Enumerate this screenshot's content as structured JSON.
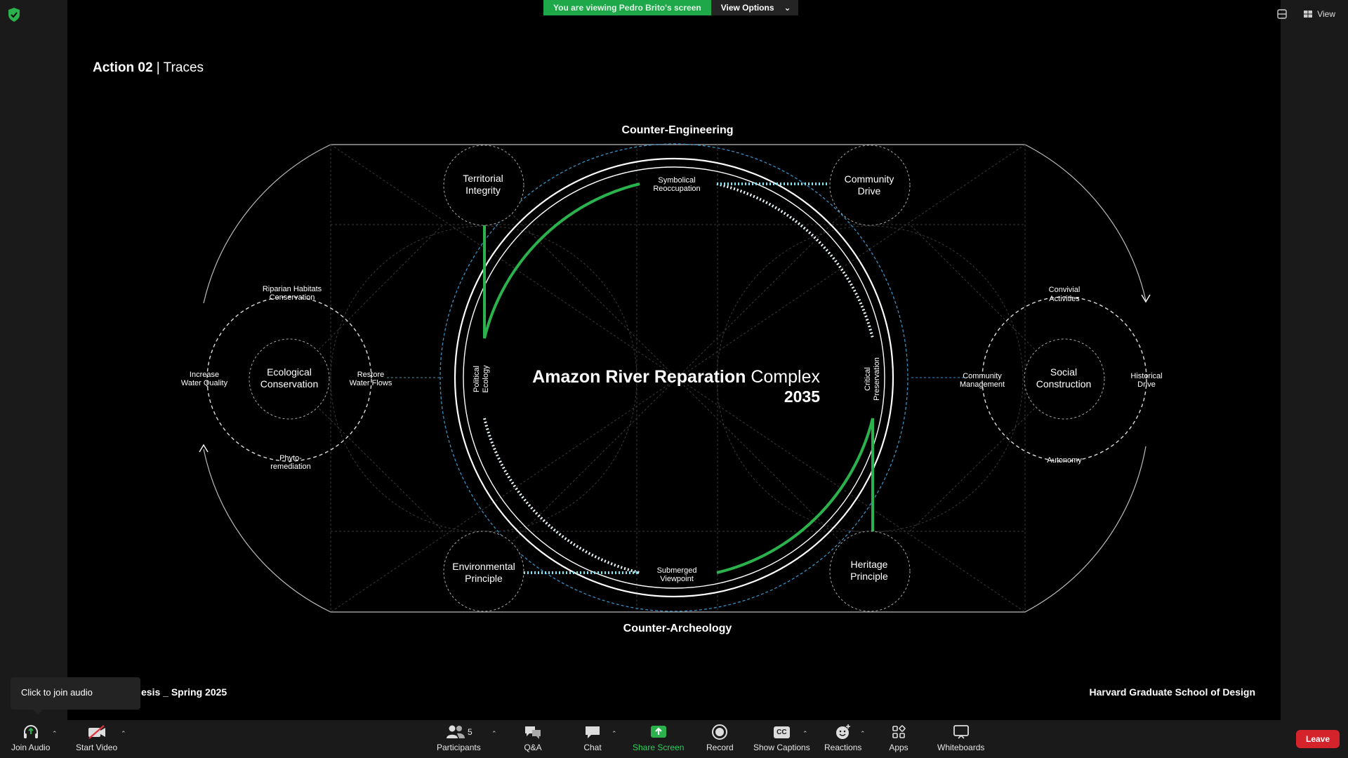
{
  "share_banner": {
    "message": "You are viewing Pedro Brito's screen",
    "view_options": "View Options"
  },
  "top_right": {
    "view_label": "View"
  },
  "slide": {
    "title_bold": "Action 02",
    "title_rest": " | Traces",
    "footer_left": "esis _ Spring 2025",
    "footer_right": "Harvard Graduate School of Design",
    "top_label": "Counter-Engineering",
    "bottom_label": "Counter-Archeology",
    "center_bold": "Amazon River Reparation",
    "center_light": " Complex",
    "center_year": "2035",
    "nodes": {
      "territorial": [
        "Territorial",
        "Integrity"
      ],
      "community": [
        "Community",
        "Drive"
      ],
      "environmental": [
        "Environmental",
        "Principle"
      ],
      "heritage": [
        "Heritage",
        "Principle"
      ],
      "ecological": [
        "Ecological",
        "Conservation"
      ],
      "social": [
        "Social",
        "Construction"
      ]
    },
    "labels": {
      "symbolical": [
        "Symbolical",
        "Reoccupation"
      ],
      "submerged": [
        "Submerged",
        "Viewpoint"
      ],
      "political": [
        "Political",
        "Ecology"
      ],
      "critical": [
        "Critical",
        "Preservation"
      ],
      "riparian": [
        "Riparian Habitats",
        "Conservation"
      ],
      "increase": [
        "Increase",
        "Water Quality"
      ],
      "restore": [
        "Restore",
        "Water Flows"
      ],
      "phyto": [
        "Phyto-",
        "remediation"
      ],
      "convivial": [
        "Convivial",
        "Activities"
      ],
      "community_mgmt": [
        "Community",
        "Management"
      ],
      "historical": [
        "Historical",
        "Drive"
      ],
      "autonomy": [
        "Autonomy"
      ]
    }
  },
  "tooltip": {
    "text": "Click to join audio"
  },
  "toolbar": {
    "join_audio": "Join Audio",
    "start_video": "Start Video",
    "participants": "Participants",
    "participants_count": "5",
    "qa": "Q&A",
    "chat": "Chat",
    "share_screen": "Share Screen",
    "record": "Record",
    "show_captions": "Show Captions",
    "captions_badge": "CC",
    "reactions": "Reactions",
    "apps": "Apps",
    "whiteboards": "Whiteboards",
    "leave": "Leave"
  },
  "colors": {
    "green": "#2bb24c",
    "cyan": "#7fe3f0",
    "blue_dashed": "#3a8fc4",
    "leave_red": "#d4232b",
    "share_green": "#1ea84a"
  }
}
